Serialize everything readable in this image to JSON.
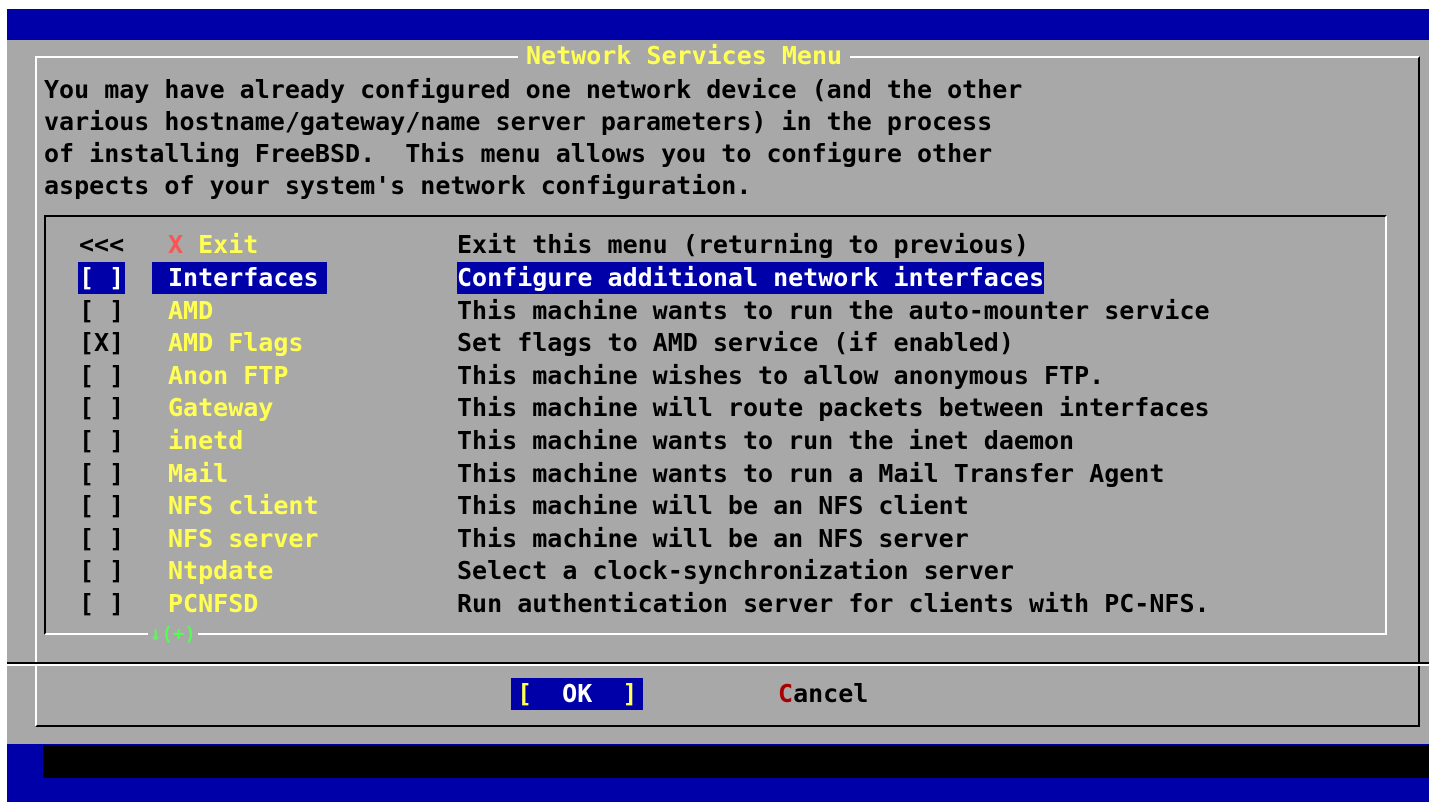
{
  "dialog": {
    "title": "Network Services Menu",
    "prompt": "You may have already configured one network device (and the other\nvarious hostname/gateway/name server parameters) in the process\nof installing FreeBSD.  This menu allows you to configure other\naspects of your system's network configuration."
  },
  "menu": {
    "exit": {
      "marker": "<<<",
      "hotkey": "X",
      "label": " Exit",
      "description": "Exit this menu (returning to previous)"
    },
    "items": [
      {
        "checkbox": "[ ]",
        "label": "Interfaces",
        "description": "Configure additional network interfaces",
        "selected": true
      },
      {
        "checkbox": "[ ]",
        "label": "AMD",
        "description": "This machine wants to run the auto-mounter service"
      },
      {
        "checkbox": "[X]",
        "label": "AMD Flags",
        "description": "Set flags to AMD service (if enabled)"
      },
      {
        "checkbox": "[ ]",
        "label": "Anon FTP",
        "description": "This machine wishes to allow anonymous FTP."
      },
      {
        "checkbox": "[ ]",
        "label": "Gateway",
        "description": "This machine will route packets between interfaces"
      },
      {
        "checkbox": "[ ]",
        "label": "inetd",
        "description": "This machine wants to run the inet daemon"
      },
      {
        "checkbox": "[ ]",
        "label": "Mail",
        "description": "This machine wants to run a Mail Transfer Agent"
      },
      {
        "checkbox": "[ ]",
        "label": "NFS client",
        "description": "This machine will be an NFS client"
      },
      {
        "checkbox": "[ ]",
        "label": "NFS server",
        "description": "This machine will be an NFS server"
      },
      {
        "checkbox": "[ ]",
        "label": "Ntpdate",
        "description": "Select a clock-synchronization server"
      },
      {
        "checkbox": "[ ]",
        "label": "PCNFSD",
        "description": "Run authentication server for clients with PC-NFS."
      }
    ],
    "more_indicator": "↓(+)"
  },
  "buttons": {
    "ok": {
      "open": "[",
      "label": "  OK  ",
      "close": "]"
    },
    "cancel": {
      "hotkey": "C",
      "label": "ancel"
    }
  },
  "colors": {
    "screen_background": "#0000a8",
    "dialog_background": "#a8a8a8",
    "title_text": "#ffff54",
    "item_label": "#ffff54",
    "hotkey_exit": "#fc5454",
    "hotkey_cancel": "#a80000",
    "more_indicator": "#54fc54",
    "selection_background": "#0000a8",
    "selection_text": "#ffffff"
  }
}
